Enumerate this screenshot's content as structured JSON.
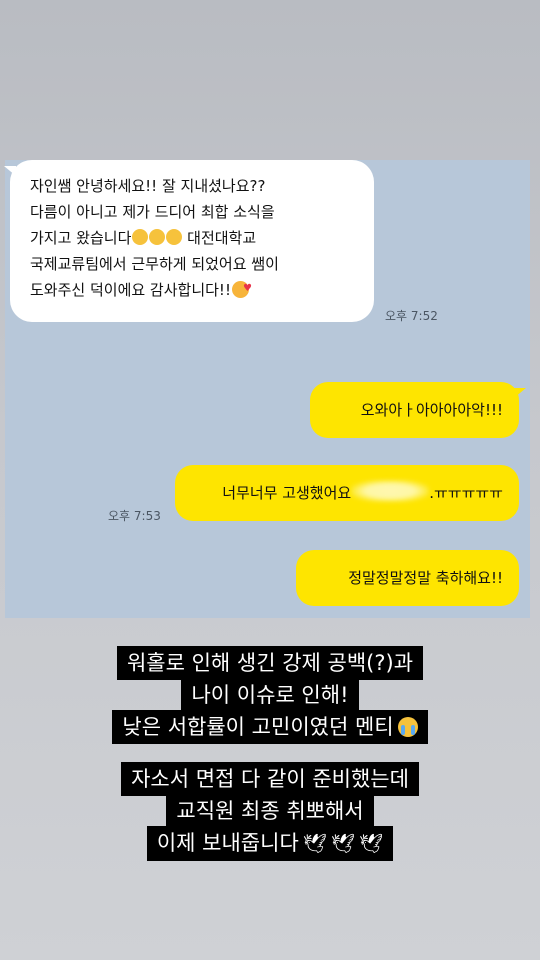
{
  "chat": {
    "incoming": {
      "lines": [
        "자인쌤 안녕하세요!! 잘 지내셨나요??",
        "다름이 아니고 제가 드디어 최합 소식을",
        "가지고 왔습니다",
        " 대전대학교",
        "국제교류팀에서 근무하게 되었어요 쌤이",
        "도와주신 덕이에요 감사합니다!!"
      ],
      "time": "오후 7:52"
    },
    "outgoing": [
      {
        "text": "오와아ㅏ아아아아악!!!"
      },
      {
        "text_before": "너무너무 고생했어요",
        "text_after": ".ㅠㅠㅠㅠㅠ",
        "time": "오후 7:53"
      },
      {
        "text": "정말정말정말 축하해요!!"
      }
    ]
  },
  "caption": {
    "block1": [
      "워홀로 인해 생긴 강제 공백(?)과",
      "나이 이슈로 인해!",
      "낮은 서합률이 고민이였던 멘티"
    ],
    "block2": [
      "자소서 면접 다 같이 준비했는데",
      "교직원 최종 취뽀해서",
      "이제 보내줍니다"
    ]
  },
  "icons": {
    "pleading": "pleading-face-icon",
    "smiling_hearts": "smiling-face-with-hearts-icon",
    "crying": "loudly-crying-face-icon",
    "dove": "dove-icon"
  },
  "colors": {
    "chat_background": "#b7c7d9",
    "incoming_bubble": "#ffffff",
    "outgoing_bubble": "#fee500",
    "caption_background": "#000000"
  }
}
